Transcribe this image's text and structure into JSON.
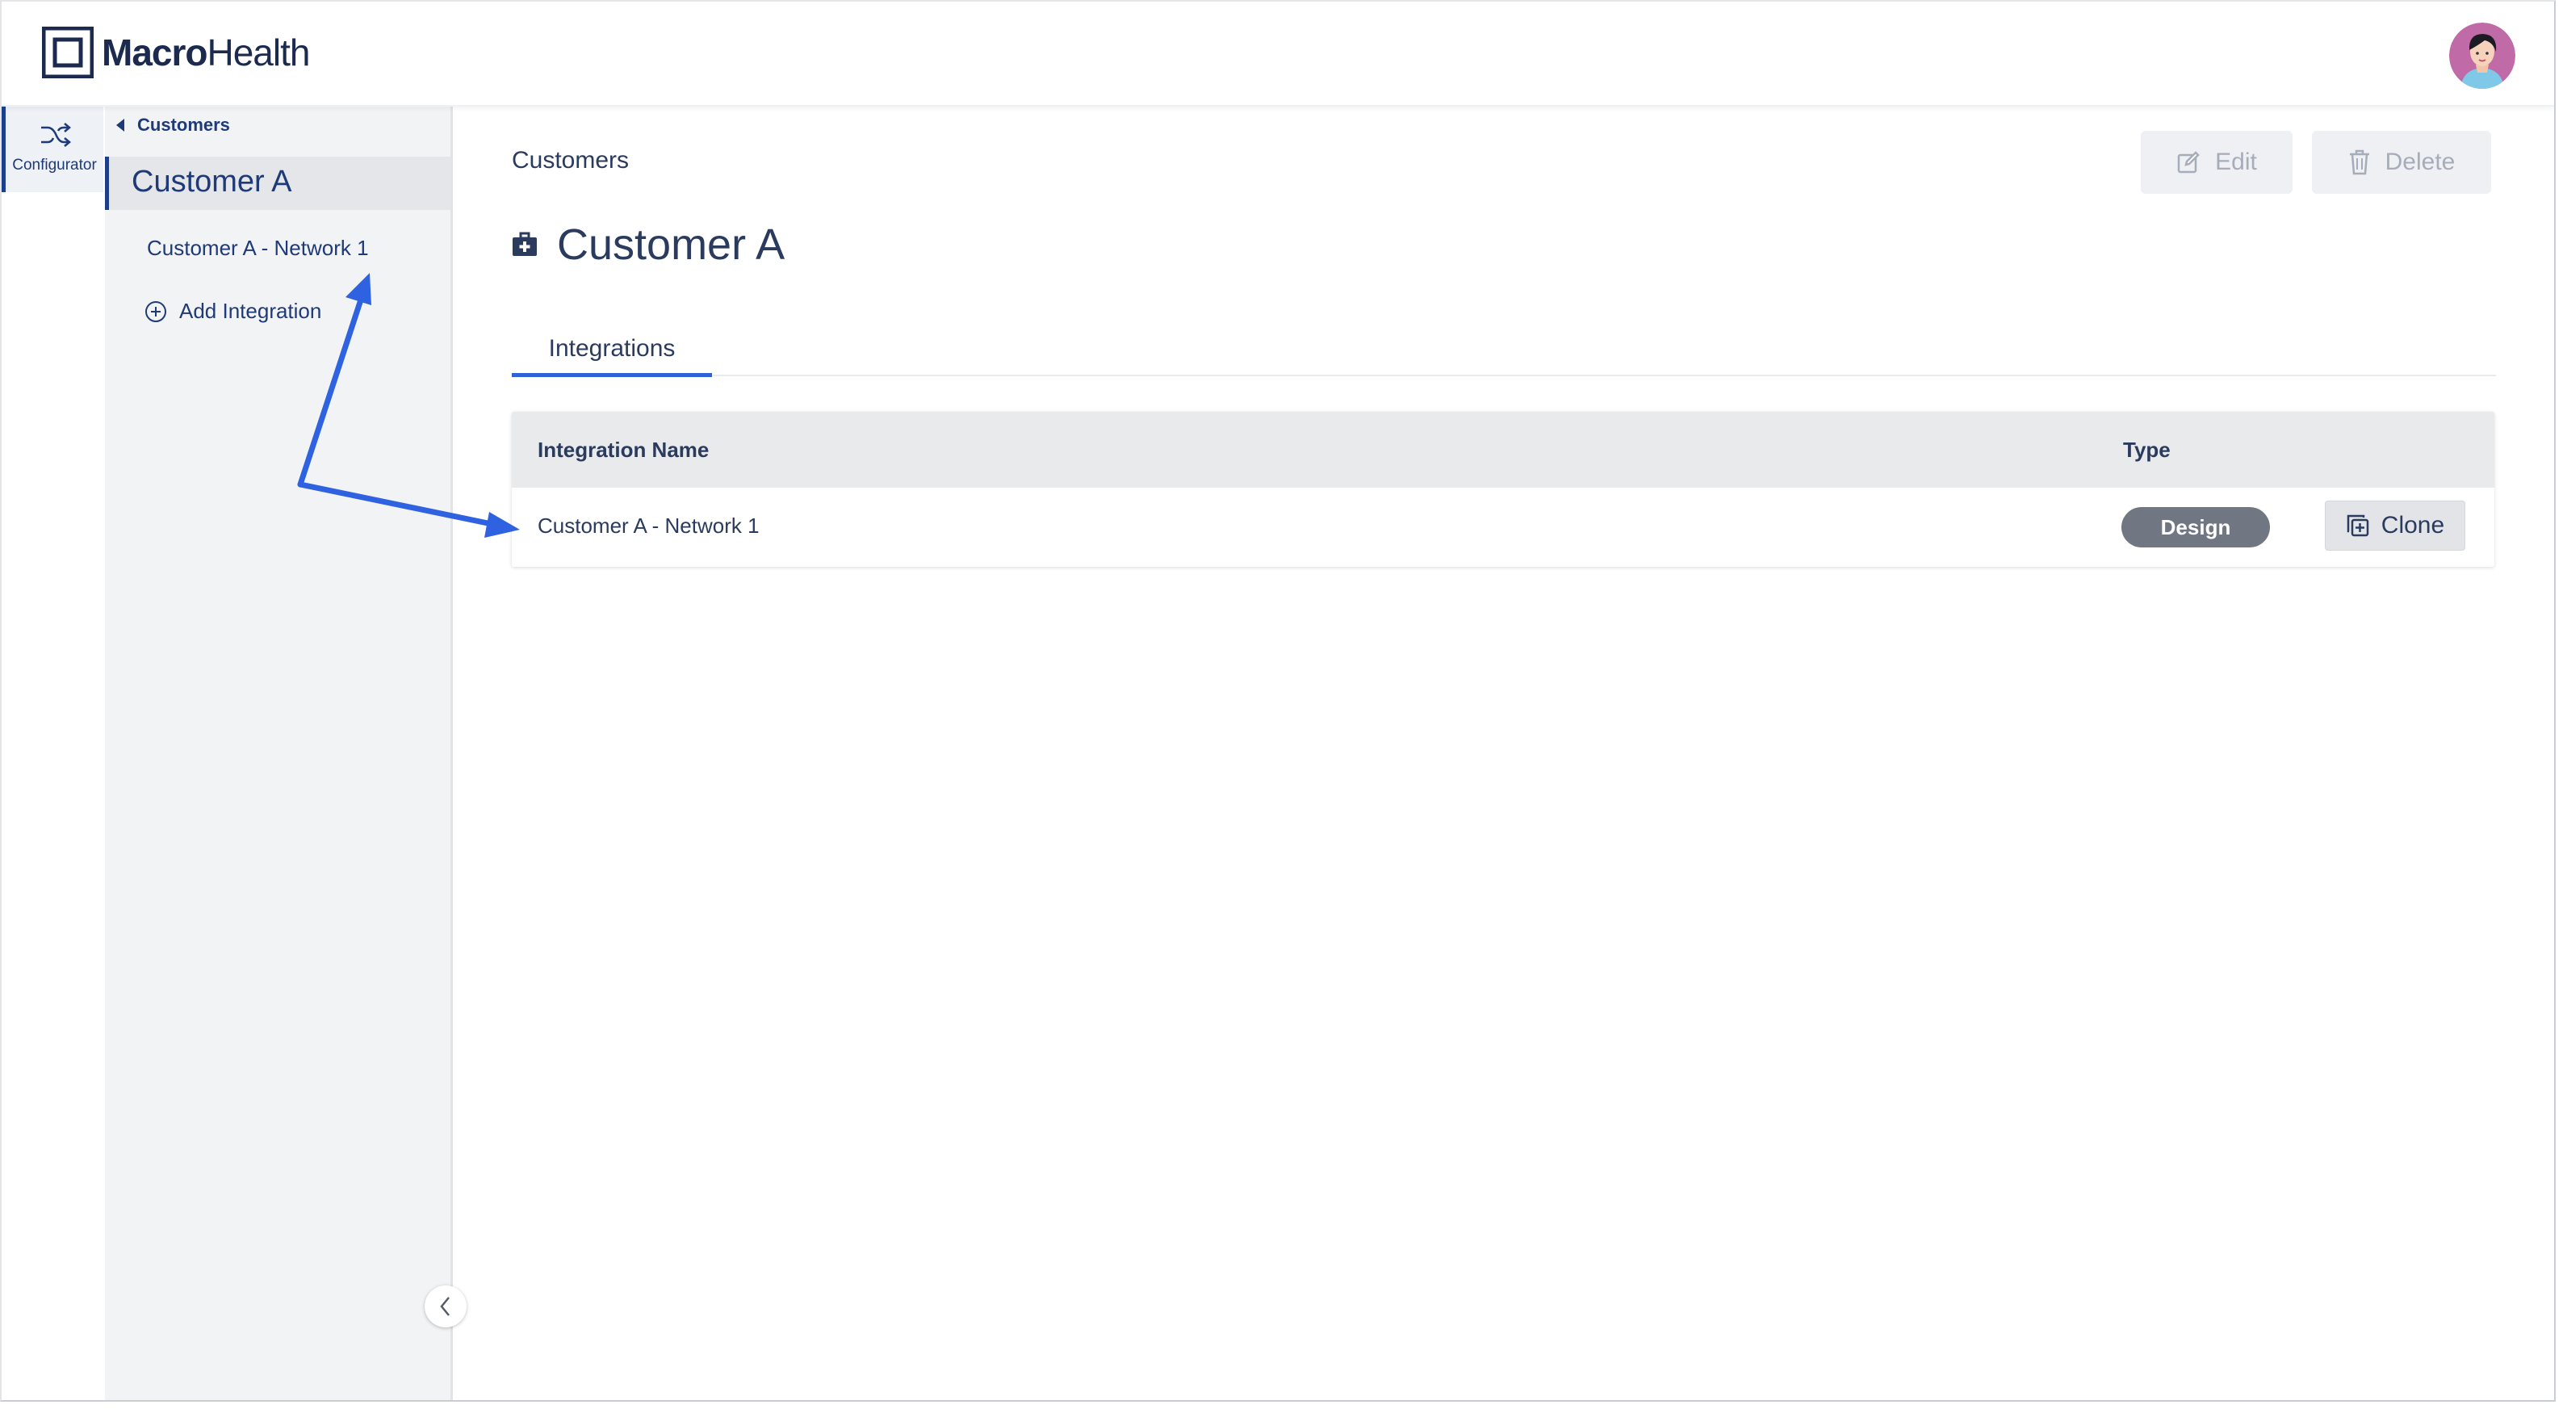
{
  "app": {
    "logo_bold": "Macro",
    "logo_light": "Health"
  },
  "rail": {
    "configurator_label": "Configurator"
  },
  "sidebar": {
    "back_label": "Customers",
    "active_item": "Customer A",
    "items": [
      {
        "label": "Customer A - Network 1"
      }
    ],
    "add_integration_label": "Add Integration"
  },
  "main": {
    "breadcrumb": "Customers",
    "edit_label": "Edit",
    "delete_label": "Delete",
    "title": "Customer A",
    "tabs": [
      {
        "label": "Integrations"
      }
    ],
    "table": {
      "columns": [
        "Integration Name",
        "Type"
      ],
      "rows": [
        {
          "name": "Customer A - Network 1",
          "type": "Design",
          "action": "Clone"
        }
      ]
    }
  },
  "colors": {
    "brand_navy": "#1b2a4e",
    "accent_blue": "#2f62d8",
    "annotation_arrow": "#2f62e0",
    "badge_gray": "#707782"
  }
}
